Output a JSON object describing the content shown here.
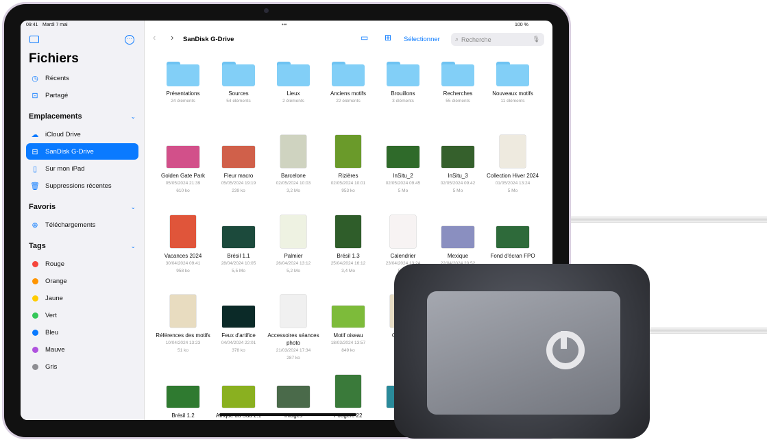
{
  "status": {
    "time": "09:41",
    "date": "Mardi 7 mai",
    "battery": "100 %"
  },
  "sidebar": {
    "title": "Fichiers",
    "top_items": [
      {
        "label": "Récents",
        "icon": "clock-icon"
      },
      {
        "label": "Partagé",
        "icon": "shared-folder-icon"
      }
    ],
    "locations_header": "Emplacements",
    "locations": [
      {
        "label": "iCloud Drive",
        "icon": "cloud-icon"
      },
      {
        "label": "SanDisk G-Drive",
        "icon": "drive-icon",
        "selected": true
      },
      {
        "label": "Sur mon iPad",
        "icon": "ipad-icon"
      },
      {
        "label": "Suppressions récentes",
        "icon": "trash-icon"
      }
    ],
    "favorites_header": "Favoris",
    "favorites": [
      {
        "label": "Téléchargements",
        "icon": "download-icon"
      }
    ],
    "tags_header": "Tags",
    "tags": [
      {
        "label": "Rouge",
        "color": "#f5463c"
      },
      {
        "label": "Orange",
        "color": "#ff9500"
      },
      {
        "label": "Jaune",
        "color": "#ffcc00"
      },
      {
        "label": "Vert",
        "color": "#34c759"
      },
      {
        "label": "Bleu",
        "color": "#0a7aff"
      },
      {
        "label": "Mauve",
        "color": "#af52de"
      },
      {
        "label": "Gris",
        "color": "#8e8e93"
      }
    ]
  },
  "toolbar": {
    "title": "SanDisk G-Drive",
    "select": "Sélectionner",
    "search_placeholder": "Recherche"
  },
  "folders": [
    {
      "name": "Présentations",
      "meta": "24 éléments"
    },
    {
      "name": "Sources",
      "meta": "54 éléments"
    },
    {
      "name": "Lieux",
      "meta": "2 éléments"
    },
    {
      "name": "Anciens motifs",
      "meta": "22 éléments"
    },
    {
      "name": "Brouillons",
      "meta": "3 éléments"
    },
    {
      "name": "Recherches",
      "meta": "55 éléments"
    },
    {
      "name": "Nouveaux motifs",
      "meta": "11 éléments"
    }
  ],
  "files": [
    [
      {
        "name": "Golden Gate Park",
        "date": "05/05/2024 21:39",
        "size": "610 ko",
        "c": "#d2508a"
      },
      {
        "name": "Fleur macro",
        "date": "05/05/2024 19:19",
        "size": "239 ko",
        "c": "#d0604a"
      },
      {
        "name": "Barcelone",
        "date": "02/05/2024 10:03",
        "size": "3,2 Mo",
        "c": "#cfd3c0",
        "tall": true
      },
      {
        "name": "Rizières",
        "date": "02/05/2024 10:01",
        "size": "953 ko",
        "c": "#6a9a2a",
        "tall": true
      },
      {
        "name": "InSitu_2",
        "date": "02/05/2024 09:45",
        "size": "5 Mo",
        "c": "#2f6a2a"
      },
      {
        "name": "InSitu_3",
        "date": "02/05/2024 09:42",
        "size": "5 Mo",
        "c": "#35602c"
      },
      {
        "name": "Collection Hiver 2024",
        "date": "01/05/2024 13:24",
        "size": "5 Mo",
        "c": "#eeeadf",
        "tall": true
      }
    ],
    [
      {
        "name": "Vacances 2024",
        "date": "30/04/2024 09:41",
        "size": "958 ko",
        "c": "#e0553a",
        "tall": true
      },
      {
        "name": "Brésil 1.1",
        "date": "28/04/2024 10:05",
        "size": "5,5 Mo",
        "c": "#1c4a3c"
      },
      {
        "name": "Palmier",
        "date": "26/04/2024 13:12",
        "size": "5,2 Mo",
        "c": "#eef2e2",
        "tall": true
      },
      {
        "name": "Brésil 1.3",
        "date": "25/04/2024 16:12",
        "size": "3,4 Mo",
        "c": "#2f5d2a",
        "tall": true
      },
      {
        "name": "Calendrier",
        "date": "23/04/2024 13:24",
        "size": "5 Mo",
        "c": "#f7f3f3",
        "tall": true
      },
      {
        "name": "Mexique",
        "date": "22/04/2024 20:52",
        "size": "",
        "c": "#8a8fc0"
      },
      {
        "name": "Fond d'écran FPO",
        "date": "",
        "size": "",
        "c": "#2e6a3a"
      }
    ],
    [
      {
        "name": "Références des motifs",
        "date": "10/04/2024 13:23",
        "size": "51 ko",
        "c": "#e8dcc0",
        "tall": true
      },
      {
        "name": "Feux d'artifice",
        "date": "04/04/2024 22:01",
        "size": "378 ko",
        "c": "#0b2a28"
      },
      {
        "name": "Accessoires séances photo",
        "date": "21/03/2024 17:34",
        "size": "287 ko",
        "c": "#f0f0f0",
        "tall": true
      },
      {
        "name": "Motif oiseau",
        "date": "18/03/2024 13:57",
        "size": "849 ko",
        "c": "#7dbb3a"
      },
      {
        "name": "O… l'a…",
        "date": "04/03…",
        "size": "",
        "c": "#e6dcc4",
        "tall": true
      }
    ],
    [
      {
        "name": "Brésil 1.2",
        "date": "",
        "size": "",
        "c": "#2f7a30"
      },
      {
        "name": "Afrique du Sud 2.1",
        "date": "",
        "size": "",
        "c": "#8ab020"
      },
      {
        "name": "Images",
        "date": "",
        "size": "",
        "c": "#4a6a4a"
      },
      {
        "name": "Fougère 22",
        "date": "",
        "size": "",
        "c": "#3a7a3a",
        "tall": true
      },
      {
        "name": "Tha…",
        "date": "",
        "size": "",
        "c": "#2a8a9a"
      }
    ]
  ]
}
